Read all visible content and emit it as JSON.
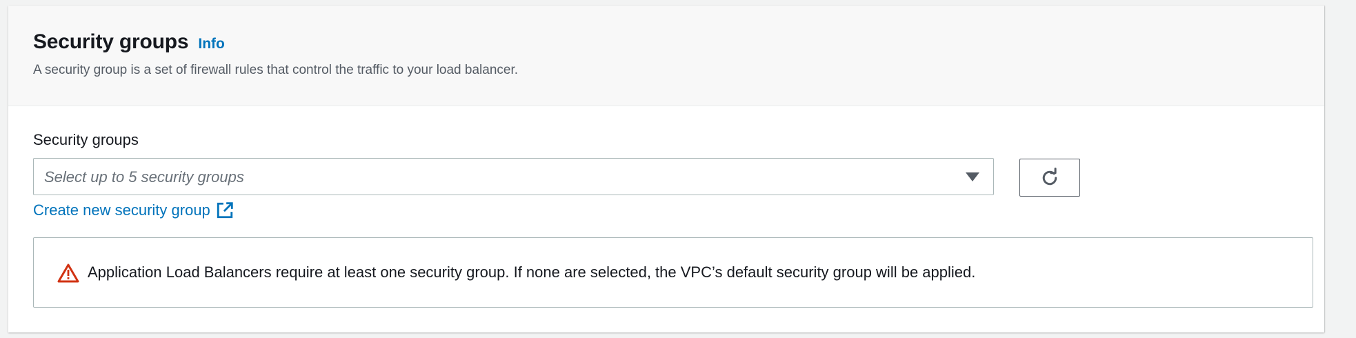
{
  "header": {
    "title": "Security groups",
    "info_label": "Info",
    "description": "A security group is a set of firewall rules that control the traffic to your load balancer."
  },
  "field": {
    "label": "Security groups",
    "placeholder": "Select up to 5 security groups"
  },
  "create_link": {
    "label": "Create new security group"
  },
  "alert": {
    "type": "warning",
    "message": "Application Load Balancers require at least one security group. If none are selected, the VPC’s default security group will be applied."
  },
  "icons": {
    "caret": "chevron-down-icon",
    "refresh": "refresh-icon",
    "external_link": "external-link-icon",
    "warning": "warning-icon"
  },
  "colors": {
    "link": "#0073bb",
    "warning": "#d13212",
    "text": "#16191f",
    "muted": "#545b64"
  }
}
